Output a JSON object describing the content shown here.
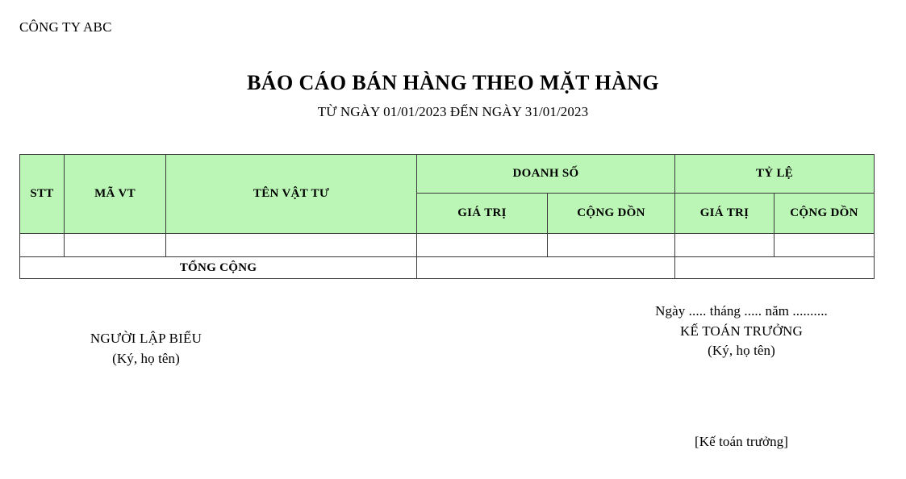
{
  "document": {
    "company": "CÔNG TY ABC",
    "title": "BÁO CÁO BÁN HÀNG THEO MẶT HÀNG",
    "subtitle": "TỪ NGÀY 01/01/2023 ĐẾN NGÀY 31/01/2023",
    "period": {
      "from_date": "01/01/2023",
      "to_date": "31/01/2023"
    }
  },
  "table": {
    "header": {
      "stt": "STT",
      "ma_vt": "MÃ VT",
      "ten_vat_tu": "TÊN VẬT TƯ",
      "doanh_so": "DOANH SỐ",
      "ty_le": "TỶ LỆ",
      "doanh_so_gia_tri": "GIÁ TRỊ",
      "doanh_so_cong_don": "CỘNG DỒN",
      "ty_le_gia_tri": "GIÁ TRỊ",
      "ty_le_cong_don": "CỘNG DỒN"
    },
    "rows": [
      {
        "stt": "",
        "ma_vt": "",
        "ten_vat_tu": "",
        "doanh_so_gia_tri": "",
        "doanh_so_cong_don": "",
        "ty_le_gia_tri": "",
        "ty_le_cong_don": ""
      }
    ],
    "total": {
      "label": "TỔNG CỘNG",
      "doanh_so": "",
      "ty_le": ""
    },
    "header_background": "#BCF6B6",
    "border_color": "#3A3A3A"
  },
  "signatures": {
    "left": {
      "role": "NGƯỜI LẬP BIỂU",
      "note": "(Ký, họ tên)"
    },
    "right": {
      "date_line": "Ngày ..... tháng ..... năm ..........",
      "role": "KẾ TOÁN TRƯỞNG",
      "note": "(Ký, họ tên)"
    }
  },
  "footer": {
    "tag": "[Kế toán trưởng]"
  }
}
